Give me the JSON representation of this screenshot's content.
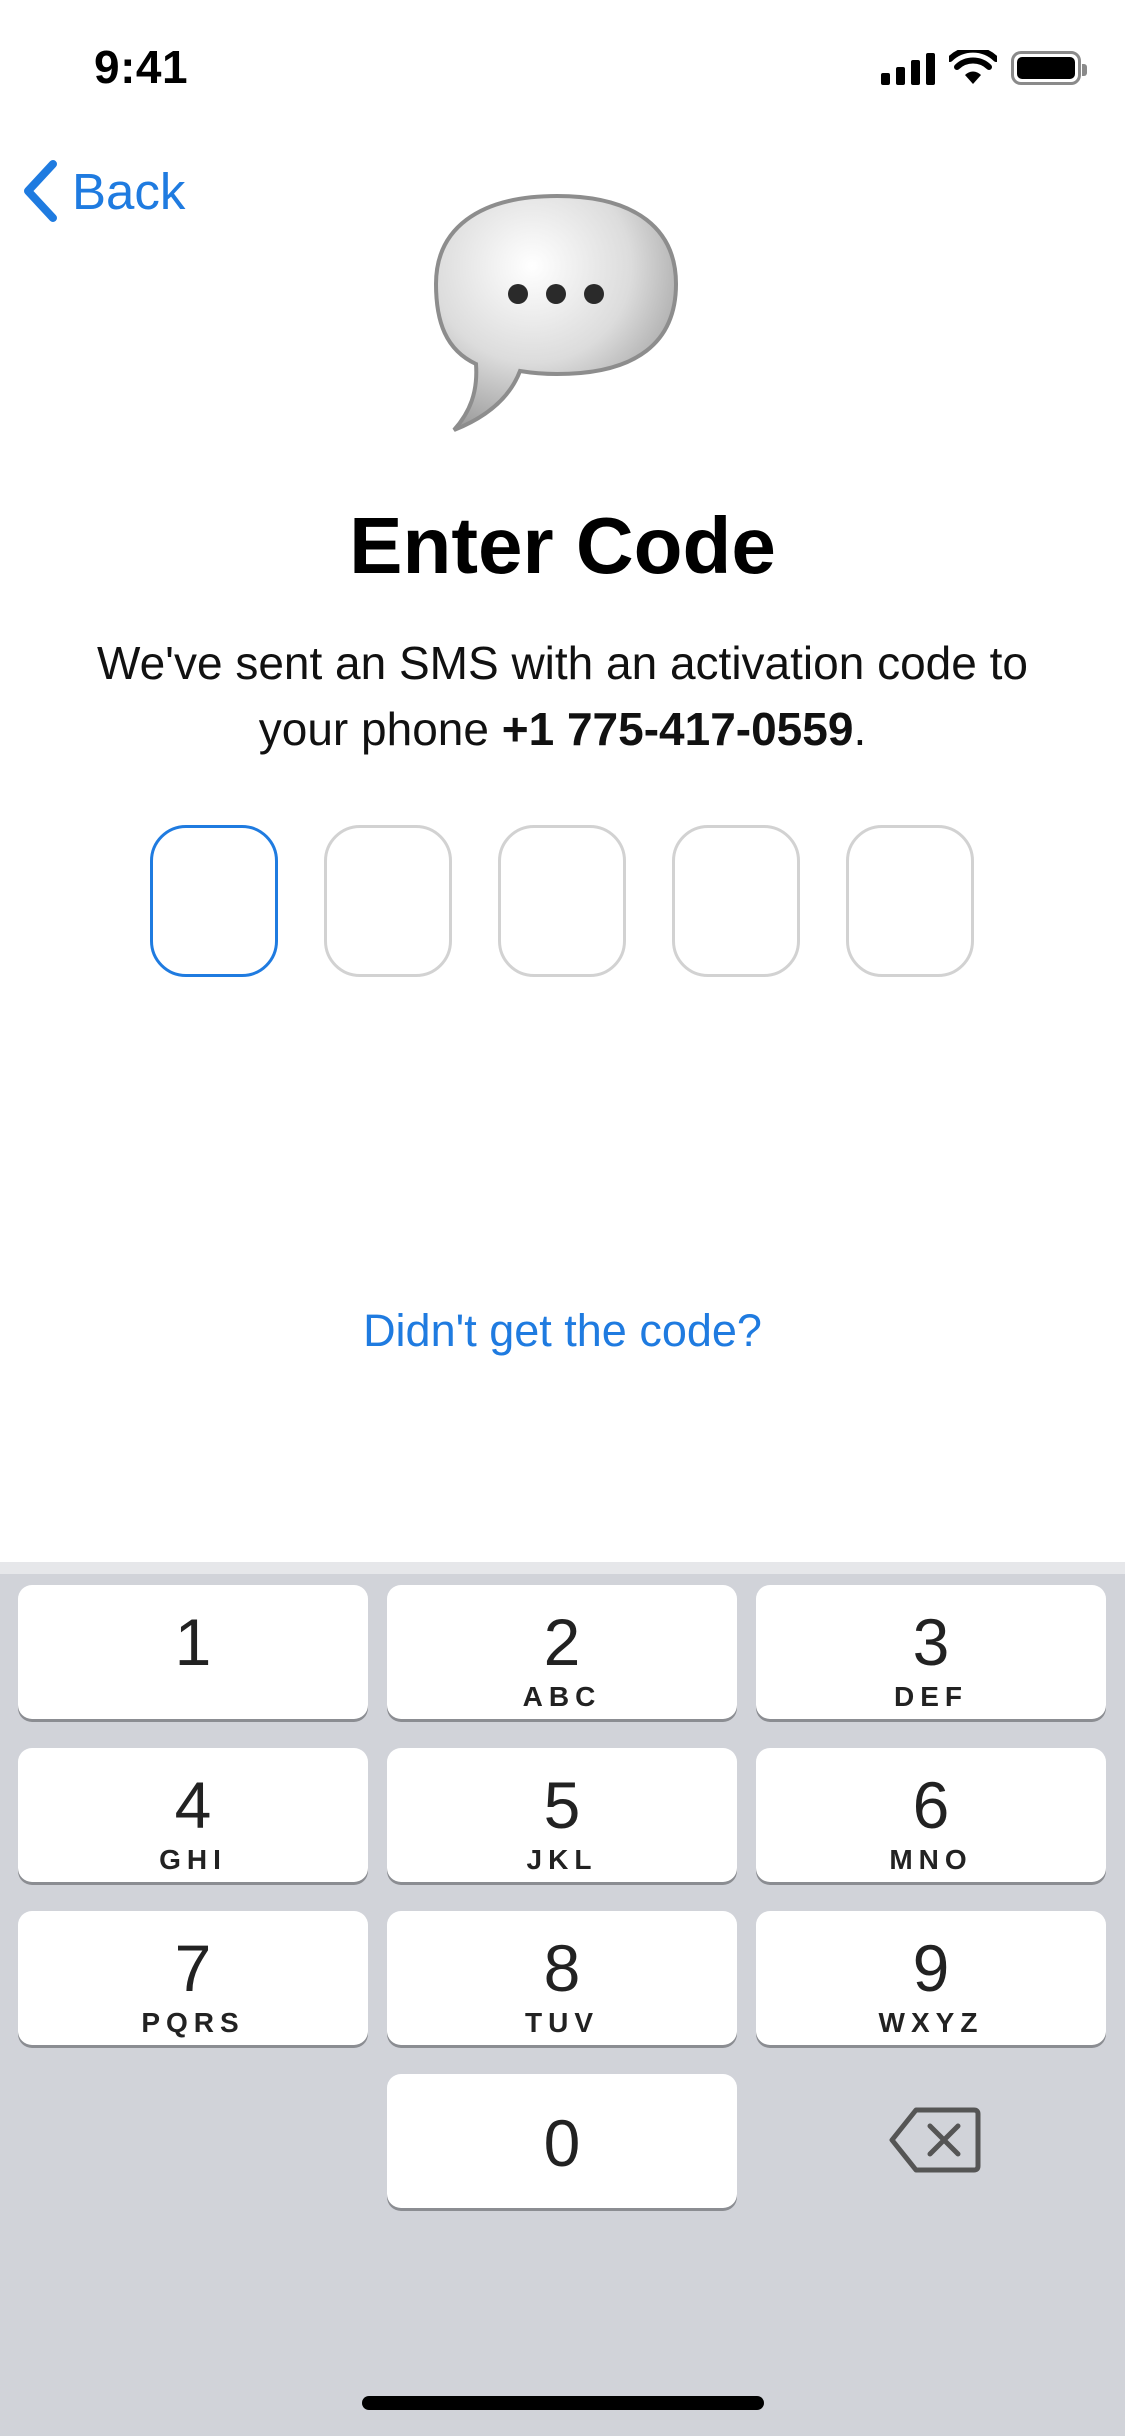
{
  "status": {
    "time": "9:41"
  },
  "nav": {
    "back_label": "Back"
  },
  "header": {
    "title": "Enter Code",
    "subtitle_prefix": "We've sent an SMS with an activation code to your phone ",
    "phone": "+1 775-417-0559",
    "subtitle_suffix": "."
  },
  "code_input": {
    "length": 5,
    "active_index": 0,
    "values": [
      "",
      "",
      "",
      "",
      ""
    ]
  },
  "resend": {
    "label": "Didn't get the code?"
  },
  "keypad": {
    "keys": [
      {
        "num": "1",
        "letters": ""
      },
      {
        "num": "2",
        "letters": "ABC"
      },
      {
        "num": "3",
        "letters": "DEF"
      },
      {
        "num": "4",
        "letters": "GHI"
      },
      {
        "num": "5",
        "letters": "JKL"
      },
      {
        "num": "6",
        "letters": "MNO"
      },
      {
        "num": "7",
        "letters": "PQRS"
      },
      {
        "num": "8",
        "letters": "TUV"
      },
      {
        "num": "9",
        "letters": "WXYZ"
      },
      {
        "num": "0",
        "letters": ""
      }
    ],
    "delete_icon": "backspace-icon"
  },
  "colors": {
    "accent": "#1f7be0",
    "keyboard_bg": "#d1d3d9",
    "box_border": "#d2d2d2"
  }
}
